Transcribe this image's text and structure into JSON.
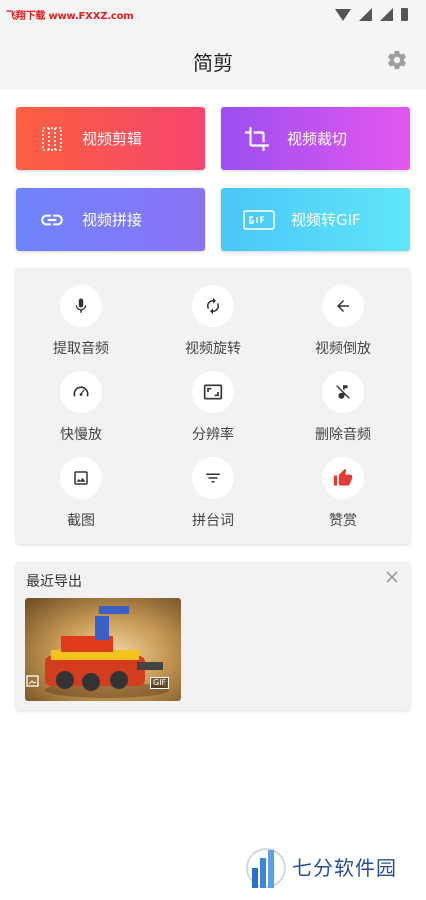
{
  "status_bar": {
    "watermark": "飞翔下载 www.FXXZ.com"
  },
  "app_bar": {
    "title": "简剪",
    "settings_icon": "gear-icon"
  },
  "feature_cards": [
    {
      "label": "视频剪辑",
      "icon": "film-strip-icon",
      "gradient": [
        "#fc5f3f",
        "#f7466e"
      ]
    },
    {
      "label": "视频裁切",
      "icon": "crop-icon",
      "gradient": [
        "#9b4ff0",
        "#e457f0"
      ]
    },
    {
      "label": "视频拼接",
      "icon": "link-icon",
      "gradient": [
        "#6f84fa",
        "#8a73f6"
      ]
    },
    {
      "label": "视频转GIF",
      "icon": "gif-icon",
      "gradient": [
        "#4ac6f7",
        "#5fe6f9"
      ]
    }
  ],
  "tools": [
    {
      "label": "提取音频",
      "icon": "microphone-icon"
    },
    {
      "label": "视频旋转",
      "icon": "rotate-icon"
    },
    {
      "label": "视频倒放",
      "icon": "arrow-left-icon"
    },
    {
      "label": "快慢放",
      "icon": "speedometer-icon"
    },
    {
      "label": "分辨率",
      "icon": "aspect-ratio-icon"
    },
    {
      "label": "删除音频",
      "icon": "music-off-icon"
    },
    {
      "label": "截图",
      "icon": "image-icon"
    },
    {
      "label": "拼台词",
      "icon": "filter-lines-icon"
    },
    {
      "label": "赞赏",
      "icon": "thumbs-up-icon"
    }
  ],
  "recent": {
    "title": "最近导出",
    "close_icon": "close-icon",
    "items": [
      {
        "badge": "GIF",
        "type_icon": "image-type-icon"
      }
    ]
  },
  "brand_watermark": {
    "text": "七分软件园"
  },
  "colors": {
    "accent_red": "#f7466e",
    "thumbs_up": "#e53935",
    "icon_dark": "#333333"
  }
}
